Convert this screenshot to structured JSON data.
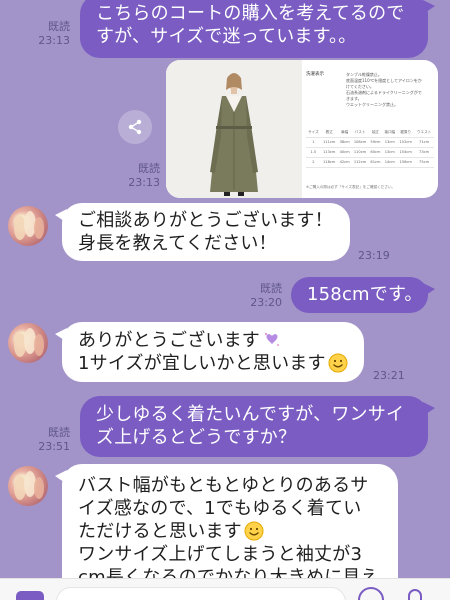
{
  "messages": [
    {
      "id": "m1",
      "dir": "out",
      "lines": [
        "こちらのコートの購入を考えてるので",
        "すが、サイズで迷っています。。"
      ],
      "read": "既読",
      "time": "23:13"
    },
    {
      "id": "m2",
      "dir": "out",
      "type": "image",
      "read": "既読",
      "time": "23:13",
      "spec": {
        "care_title": "洗濯表示",
        "care_lines": [
          "タンブル乾燥禁止。",
          "底面温度110℃を限度としてアイロンをか",
          "けてください。",
          "石油系溶剤によるドライクリーニングがで",
          "きます。",
          "ウエットクリーニング禁止。"
        ],
        "table_header": [
          "サイズ",
          "着丈",
          "肩幅",
          "バスト",
          "袖丈",
          "袖口幅",
          "裾周り",
          "ウエスト"
        ],
        "table_rows": [
          [
            "1",
            "111cm",
            "38cm",
            "108cm",
            "59cm",
            "13cm",
            "152cm",
            "71cm"
          ],
          [
            "1.5",
            "113cm",
            "40cm",
            "110cm",
            "60cm",
            "13cm",
            "154cm",
            "73cm"
          ],
          [
            "2",
            "118cm",
            "42cm",
            "112cm",
            "61cm",
            "14cm",
            "156cm",
            "75cm"
          ]
        ],
        "note": "※ご購入の際は必ず「サイズ表記」をご確認ください。"
      }
    },
    {
      "id": "m3",
      "dir": "in",
      "lines": [
        "ご相談ありがとうございます！",
        "身長を教えてください！"
      ],
      "time": "23:19"
    },
    {
      "id": "m4",
      "dir": "out",
      "lines": [
        "158cmです。"
      ],
      "read": "既読",
      "time": "23:20"
    },
    {
      "id": "m5",
      "dir": "in",
      "lines": [
        "ありがとうございます",
        "1サイズが宜しいかと思います"
      ],
      "time": "23:21"
    },
    {
      "id": "m6",
      "dir": "out",
      "lines": [
        "少しゆるく着たいんですが、ワンサイ",
        "ズ上げるとどうですか？"
      ],
      "read": "既読",
      "time": "23:51"
    },
    {
      "id": "m7",
      "dir": "in",
      "lines": [
        "バスト幅がもともとゆとりのあるサ",
        "イズ感なので、1でもゆるく着てい",
        "ただけると思います",
        "ワンサイズ上げてしまうと袖丈が3",
        "cm長くなるのでかなり大きめに見え"
      ]
    }
  ],
  "icons": {
    "share": "share-icon",
    "sparkle": "sparkle-hearts-emoji",
    "smile": "smiling-face-emoji",
    "avatar": "contact-avatar",
    "add": "plus-icon",
    "emoji": "emoji-icon",
    "mic": "mic-icon"
  },
  "colors": {
    "background": "#a294c9",
    "outgoing": "#7a5cc2",
    "incoming": "#ffffff",
    "meta": "#5f5687"
  }
}
